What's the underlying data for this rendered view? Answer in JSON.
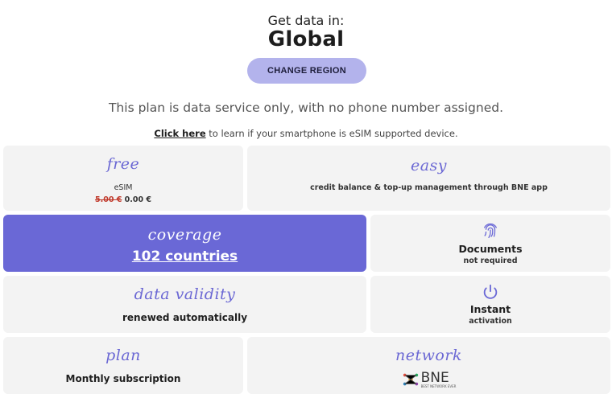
{
  "header": {
    "get_data_label": "Get data in:",
    "region": "Global",
    "change_region_label": "CHANGE REGION",
    "plan_note": "This plan is data service only, with no phone number assigned.",
    "click_here_label": "Click here",
    "esim_check_text": " to learn if your smartphone is eSIM supported device."
  },
  "cards": {
    "free": {
      "script": "free",
      "label": "eSIM",
      "old_price": "5.00 €",
      "new_price": " 0.00 €"
    },
    "easy": {
      "script": "easy",
      "text": "credit balance & top-up management through BNE app"
    },
    "coverage": {
      "script": "coverage",
      "value": "102 countries"
    },
    "documents": {
      "icon": "fingerprint-icon",
      "title": "Documents",
      "subtitle": "not required"
    },
    "validity": {
      "script": "data validity",
      "text": "renewed automatically"
    },
    "instant": {
      "icon": "power-icon",
      "title": "Instant",
      "subtitle": "activation"
    },
    "plan": {
      "script": "plan",
      "text": "Monthly subscription"
    },
    "network": {
      "script": "network",
      "logo_text": "BNE",
      "logo_tagline": "BEST NETWORK EVER"
    }
  },
  "colors": {
    "accent": "#6a68d6",
    "button": "#b3b3ec",
    "card": "#f3f3f3",
    "script": "#6b68d4"
  }
}
